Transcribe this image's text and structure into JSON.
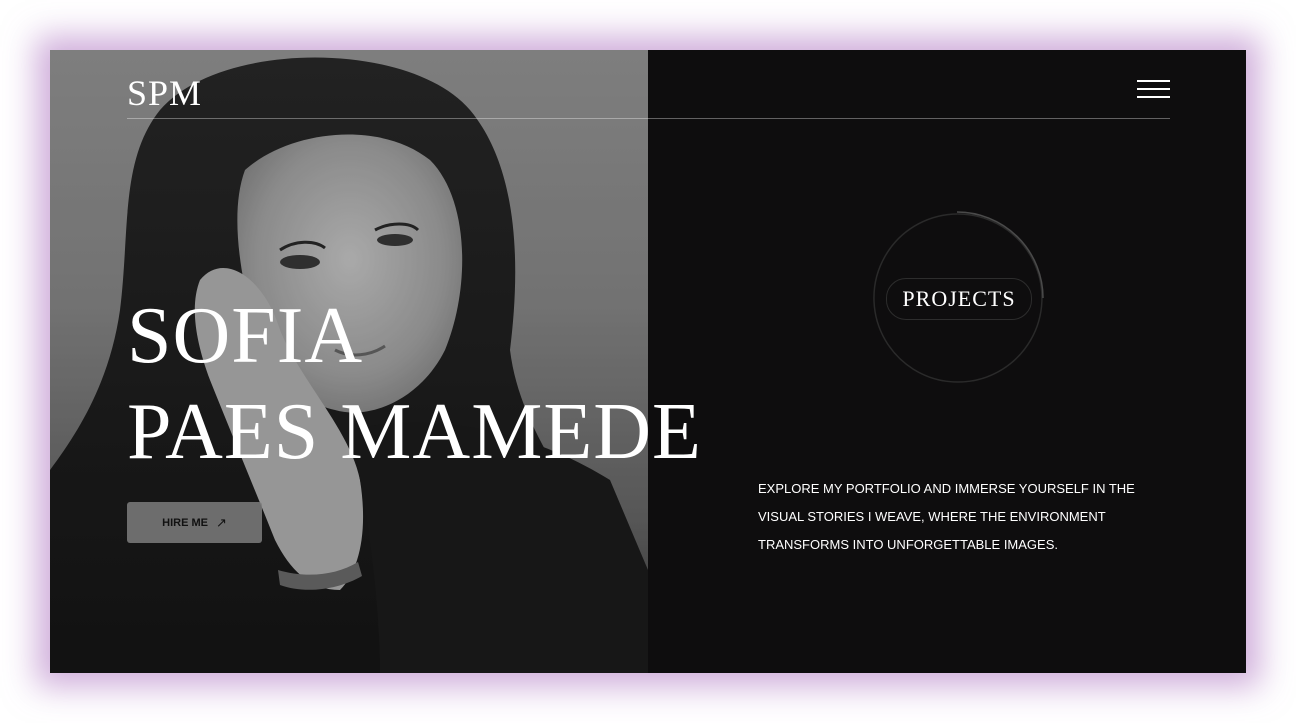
{
  "header": {
    "logo": "SPM",
    "menu_icon": "hamburger-menu-icon"
  },
  "hero": {
    "name_line1": "SOFIA",
    "name_line2": "PAES MAMEDE",
    "hire_label": "HIRE ME",
    "hire_icon": "arrow-up-right-icon",
    "photo": "portrait-photo"
  },
  "projects": {
    "label": "PROJECTS"
  },
  "intro": {
    "text": "EXPLORE MY PORTFOLIO AND IMMERSE YOURSELF IN THE VISUAL STORIES I WEAVE, WHERE THE ENVIRONMENT TRANSFORMS INTO UNFORGETTABLE IMAGES."
  },
  "colors": {
    "dark_background": "#0e0d0e",
    "text": "#ffffff",
    "glow": "#aa6ebe",
    "button": "#7d7d7d"
  }
}
